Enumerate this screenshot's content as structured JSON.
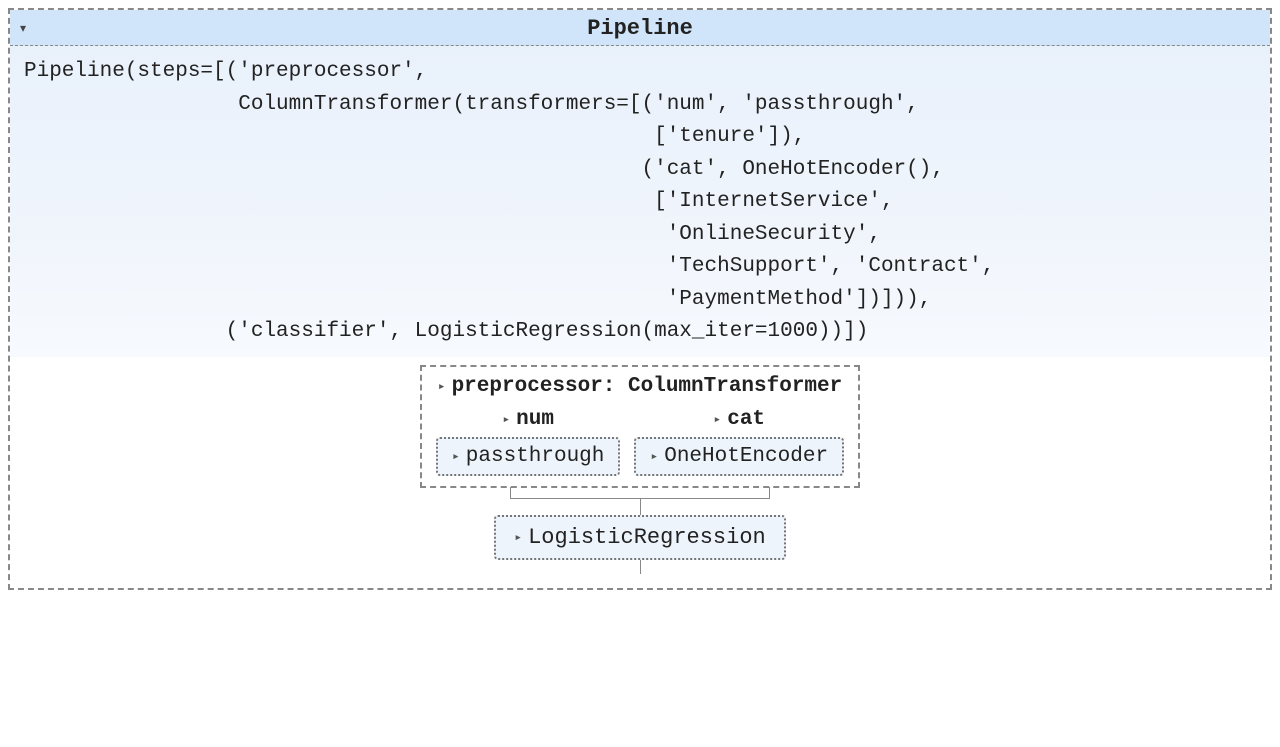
{
  "header": {
    "title": "Pipeline",
    "expanded_caret": "▾"
  },
  "code": "Pipeline(steps=[('preprocessor',\n                 ColumnTransformer(transformers=[('num', 'passthrough',\n                                                  ['tenure']),\n                                                 ('cat', OneHotEncoder(),\n                                                  ['InternetService',\n                                                   'OnlineSecurity',\n                                                   'TechSupport', 'Contract',\n                                                   'PaymentMethod'])])),\n                ('classifier', LogisticRegression(max_iter=1000))])",
  "diagram": {
    "collapsed_caret": "▸",
    "preprocessor_title": "preprocessor: ColumnTransformer",
    "num": {
      "label": "num",
      "step": "passthrough"
    },
    "cat": {
      "label": "cat",
      "step": "OneHotEncoder"
    },
    "classifier": "LogisticRegression"
  }
}
